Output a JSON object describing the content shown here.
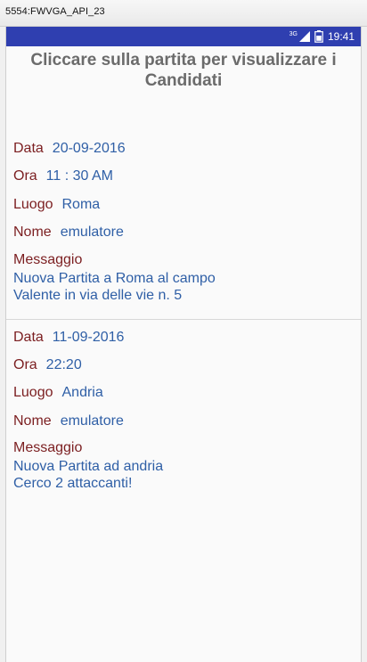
{
  "window": {
    "title": "5554:FWVGA_API_23"
  },
  "statusbar": {
    "network": "3G",
    "time": "19:41"
  },
  "header": {
    "title": "Cliccare sulla partita per visualizzare i Candidati"
  },
  "matches": [
    {
      "data_label": "Data",
      "data_value": "20-09-2016",
      "ora_label": "Ora",
      "ora_value": "11 : 30 AM",
      "luogo_label": "Luogo",
      "luogo_value": "Roma",
      "nome_label": "Nome",
      "nome_value": "emulatore",
      "messaggio_label": "Messaggio",
      "messaggio_value": "Nuova Partita a Roma al campo\nValente in via delle vie n. 5"
    },
    {
      "data_label": "Data",
      "data_value": "11-09-2016",
      "ora_label": "Ora",
      "ora_value": "22:20",
      "luogo_label": "Luogo",
      "luogo_value": "Andria",
      "nome_label": "Nome",
      "nome_value": "emulatore",
      "messaggio_label": "Messaggio",
      "messaggio_value": "Nuova Partita ad andria\nCerco 2 attaccanti!"
    }
  ]
}
